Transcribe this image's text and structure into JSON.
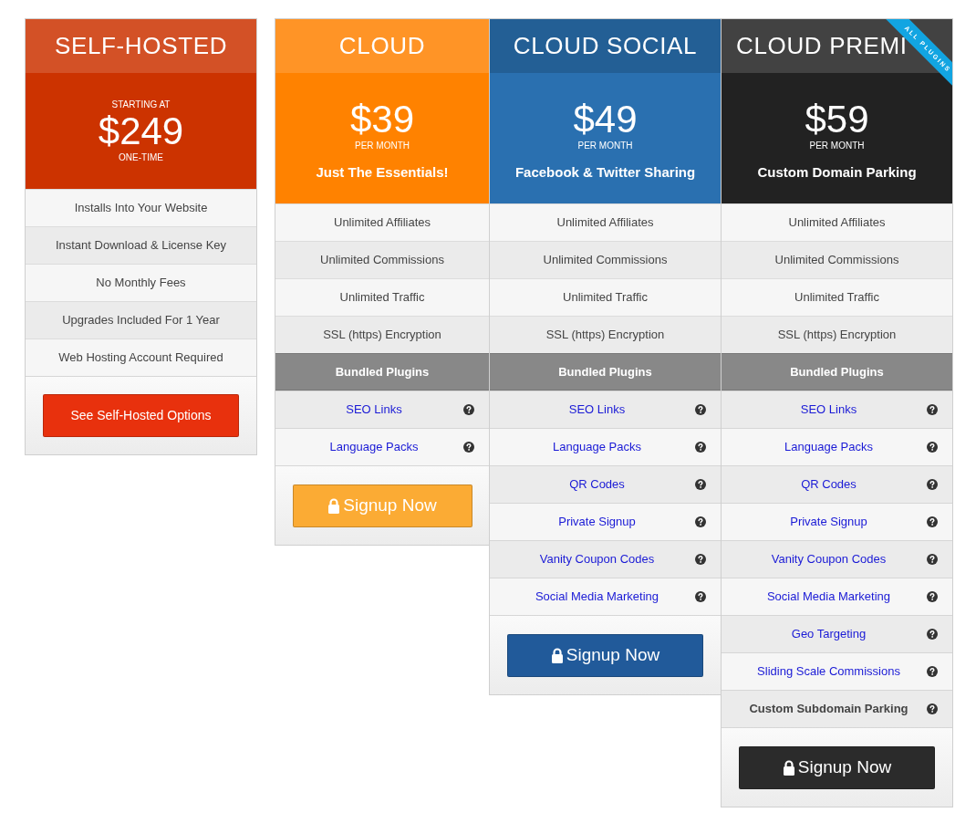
{
  "plans": [
    {
      "title": "SELF-HOSTED",
      "color": "#cc3300",
      "pre_label": "STARTING AT",
      "price": "$249",
      "period": "ONE-TIME",
      "features": [
        "Installs Into Your Website",
        "Instant Download & License Key",
        "No Monthly Fees",
        "Upgrades Included For 1 Year",
        "Web Hosting Account Required"
      ],
      "button": {
        "label": "See Self-Hosted Options",
        "color": "#e8310d",
        "lock": false
      }
    },
    {
      "title": "CLOUD",
      "color": "#ff8200",
      "price": "$39",
      "period": "PER MONTH",
      "tagline": "Just The Essentials!",
      "features": [
        "Unlimited Affiliates",
        "Unlimited Commissions",
        "Unlimited Traffic",
        "SSL (https) Encryption"
      ],
      "plugins_heading": "Bundled Plugins",
      "plugins": [
        {
          "label": "SEO Links",
          "kind": "link"
        },
        {
          "label": "Language Packs",
          "kind": "link"
        }
      ],
      "button": {
        "label": "Signup Now",
        "color": "#fbab34",
        "lock": true
      }
    },
    {
      "title": "CLOUD SOCIAL",
      "color": "#2a70b0",
      "price": "$49",
      "period": "PER MONTH",
      "tagline": "Facebook & Twitter Sharing",
      "features": [
        "Unlimited Affiliates",
        "Unlimited Commissions",
        "Unlimited Traffic",
        "SSL (https) Encryption"
      ],
      "plugins_heading": "Bundled Plugins",
      "plugins": [
        {
          "label": "SEO Links",
          "kind": "link"
        },
        {
          "label": "Language Packs",
          "kind": "link"
        },
        {
          "label": "QR Codes",
          "kind": "link"
        },
        {
          "label": "Private Signup",
          "kind": "link"
        },
        {
          "label": "Vanity Coupon Codes",
          "kind": "link"
        },
        {
          "label": "Social Media Marketing",
          "kind": "link"
        }
      ],
      "button": {
        "label": "Signup Now",
        "color": "#215a9a",
        "lock": true
      }
    },
    {
      "title": "CLOUD PREMI",
      "color": "#222222",
      "ribbon": "ALL PLUGINS",
      "price": "$59",
      "period": "PER MONTH",
      "tagline": "Custom Domain Parking",
      "features": [
        "Unlimited Affiliates",
        "Unlimited Commissions",
        "Unlimited Traffic",
        "SSL (https) Encryption"
      ],
      "plugins_heading": "Bundled Plugins",
      "plugins": [
        {
          "label": "SEO Links",
          "kind": "link"
        },
        {
          "label": "Language Packs",
          "kind": "link"
        },
        {
          "label": "QR Codes",
          "kind": "link"
        },
        {
          "label": "Private Signup",
          "kind": "link"
        },
        {
          "label": "Vanity Coupon Codes",
          "kind": "link"
        },
        {
          "label": "Social Media Marketing",
          "kind": "link"
        },
        {
          "label": "Geo Targeting",
          "kind": "link"
        },
        {
          "label": "Sliding Scale Commissions",
          "kind": "link"
        },
        {
          "label": "Custom Subdomain Parking",
          "kind": "bold"
        }
      ],
      "button": {
        "label": "Signup Now",
        "color": "#2b2b2b",
        "lock": true
      }
    }
  ]
}
